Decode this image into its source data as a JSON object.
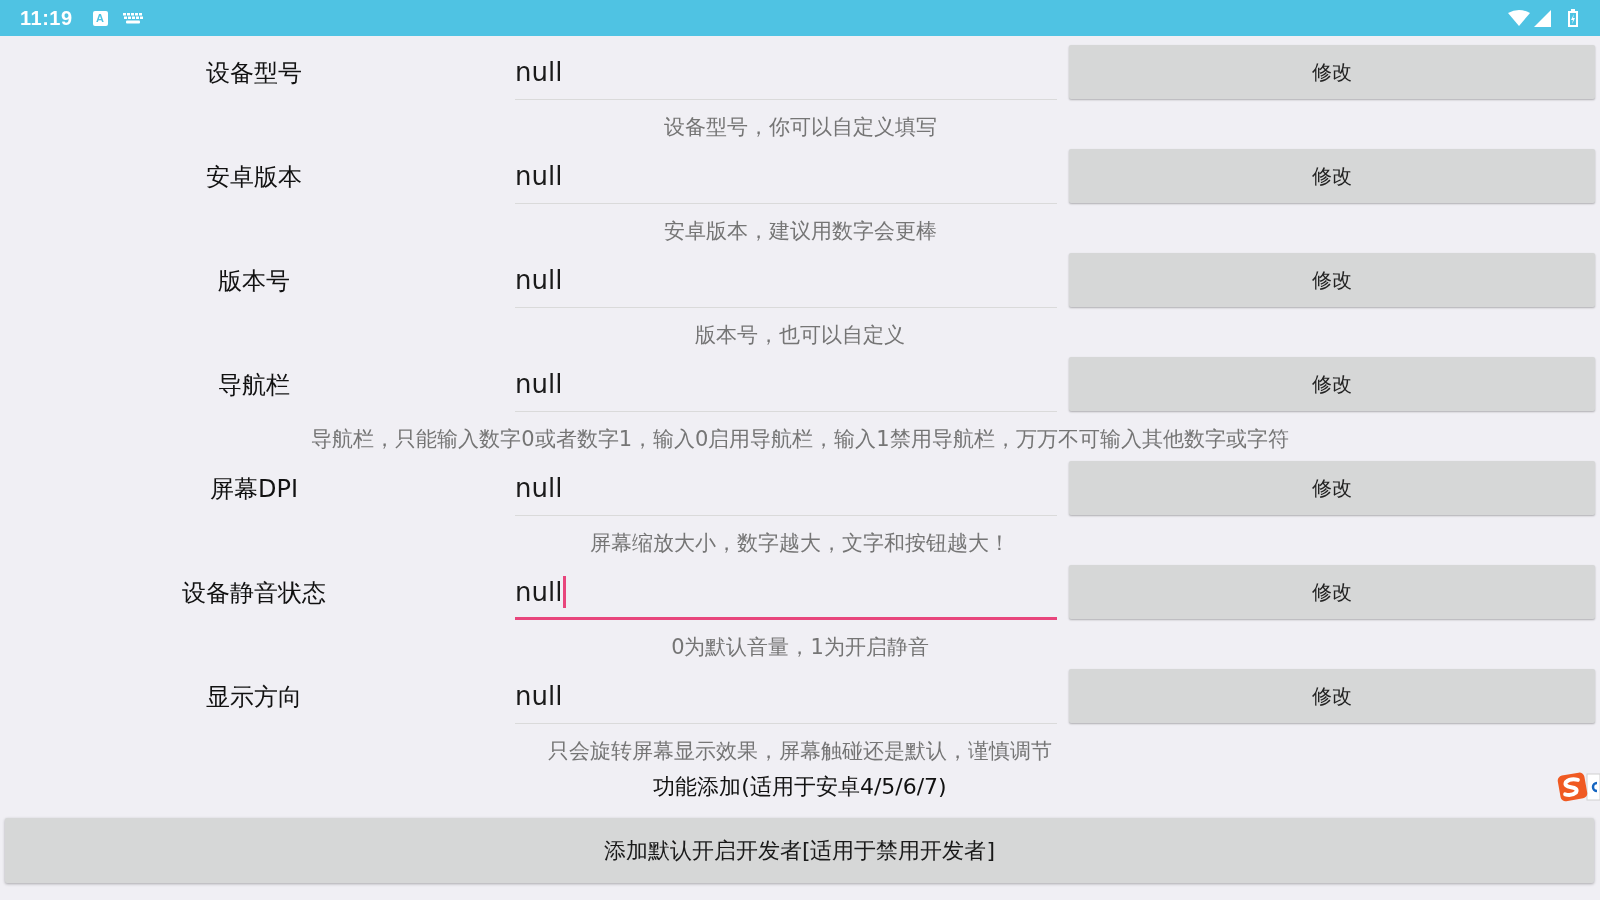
{
  "status_bar": {
    "time": "11:19",
    "input_indicator": "A"
  },
  "settings": [
    {
      "label": "设备型号",
      "value": "null",
      "focused": false,
      "button": "修改",
      "hint": "设备型号，你可以自定义填写"
    },
    {
      "label": "安卓版本",
      "value": "null",
      "focused": false,
      "button": "修改",
      "hint": "安卓版本，建议用数字会更棒"
    },
    {
      "label": "版本号",
      "value": "null",
      "focused": false,
      "button": "修改",
      "hint": "版本号，也可以自定义"
    },
    {
      "label": "导航栏",
      "value": "null",
      "focused": false,
      "button": "修改",
      "hint": "导航栏，只能输入数字0或者数字1，输入0启用导航栏，输入1禁用导航栏，万万不可输入其他数字或字符"
    },
    {
      "label": "屏幕DPI",
      "value": "null",
      "focused": false,
      "button": "修改",
      "hint": "屏幕缩放大小，数字越大，文字和按钮越大！"
    },
    {
      "label": "设备静音状态",
      "value": "null",
      "focused": true,
      "button": "修改",
      "hint": "0为默认音量，1为开启静音"
    },
    {
      "label": "显示方向",
      "value": "null",
      "focused": false,
      "button": "修改",
      "hint": "只会旋转屏幕显示效果，屏幕触碰还是默认，谨慎调节"
    }
  ],
  "section_title": "功能添加(适用于安卓4/5/6/7)",
  "action_button": "添加默认开启开发者[适用于禁用开发者]"
}
